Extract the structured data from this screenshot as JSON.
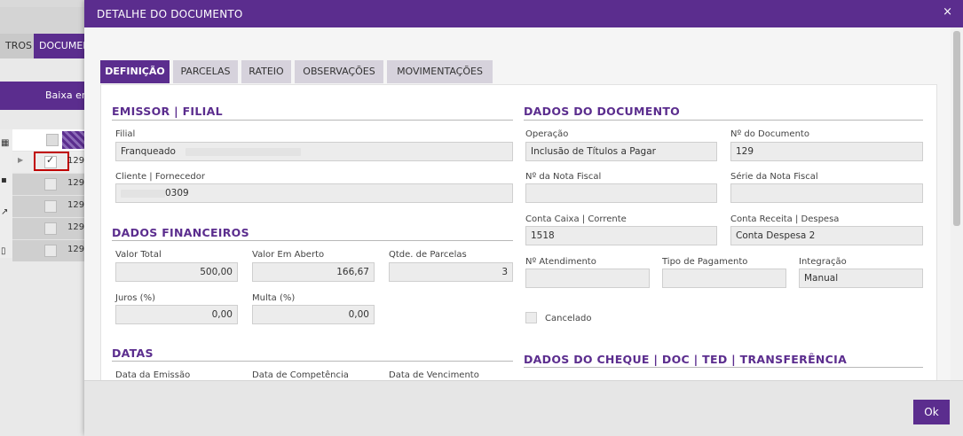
{
  "background": {
    "tab_1": "TROS",
    "tab_2": "DOCUMENTOS",
    "action_button": "Baixa em",
    "rows": [
      "129",
      "129",
      "129",
      "129",
      "129"
    ]
  },
  "modal": {
    "title": "DETALHE DO DOCUMENTO",
    "close_icon": "×",
    "ok_label": "Ok"
  },
  "tabs": [
    "DEFINIÇÃO",
    "PARCELAS",
    "RATEIO",
    "OBSERVAÇÕES",
    "MOVIMENTAÇÕES"
  ],
  "emissor": {
    "title": "EMISSOR | FILIAL",
    "filial_label": "Filial",
    "filial_value": "Franqueado",
    "cliente_label": "Cliente | Fornecedor",
    "cliente_value": "0309"
  },
  "financeiros": {
    "title": "DADOS FINANCEIROS",
    "valor_total_label": "Valor Total",
    "valor_total": "500,00",
    "valor_aberto_label": "Valor Em Aberto",
    "valor_aberto": "166,67",
    "parcelas_label": "Qtde. de Parcelas",
    "parcelas": "3",
    "juros_label": "Juros (%)",
    "juros": "0,00",
    "multa_label": "Multa (%)",
    "multa": "0,00"
  },
  "datas": {
    "title": "DATAS",
    "emissao_label": "Data da Emissão",
    "competencia_label": "Data de Competência",
    "vencimento_label": "Data de Vencimento"
  },
  "documento": {
    "title": "DADOS DO DOCUMENTO",
    "operacao_label": "Operação",
    "operacao": "Inclusão de Títulos a Pagar",
    "numero_label": "Nº do Documento",
    "numero": "129",
    "nota_label": "Nº da Nota Fiscal",
    "nota": "",
    "serie_label": "Série da Nota Fiscal",
    "serie": "",
    "conta_caixa_label": "Conta Caixa | Corrente",
    "conta_caixa": "1518",
    "conta_receita_label": "Conta Receita | Despesa",
    "conta_receita": "Conta Despesa 2",
    "atendimento_label": "Nº Atendimento",
    "atendimento": "",
    "tipo_pagamento_label": "Tipo de Pagamento",
    "tipo_pagamento": "",
    "integracao_label": "Integração",
    "integracao": "Manual",
    "cancelado_label": "Cancelado"
  },
  "cheque": {
    "title": "DADOS DO CHEQUE | DOC | TED | TRANSFERÊNCIA"
  },
  "colors": {
    "accent": "#5b2d8e",
    "field_bg": "#ececec",
    "highlight": "#c00000"
  }
}
